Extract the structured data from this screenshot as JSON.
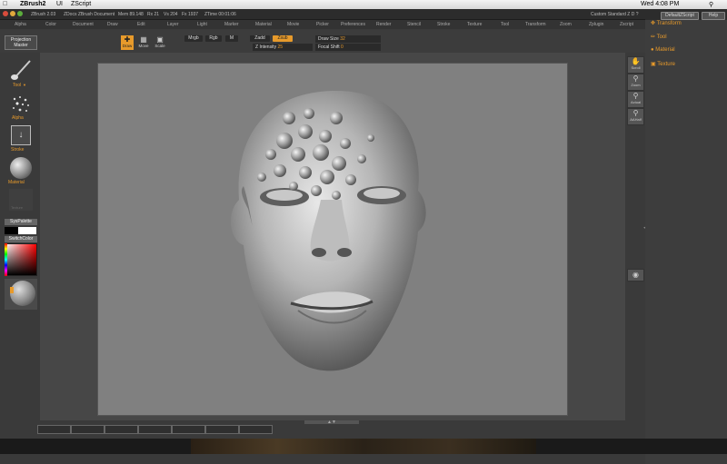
{
  "mac": {
    "app": "ZBrush2",
    "menus": [
      "UI",
      "ZScript"
    ],
    "clock": "Wed 4:08 PM"
  },
  "titlebar": {
    "version": "ZBrush 2.03",
    "doc": "ZDocs ZBrush Document",
    "mem": "Mem 89.148",
    "rx": "Rx 21",
    "vs": "Vs 204",
    "fx": "Fx 1937",
    "ztime": "ZTime 00:01:06",
    "right": "Custom Standard Z D ?",
    "default_script": "DefaultZScript",
    "help": "Help"
  },
  "menus": [
    "Alpha",
    "Color",
    "Document",
    "Draw",
    "Edit",
    "Layer",
    "Light",
    "Marker",
    "Material",
    "Movie",
    "Picker",
    "Preferences",
    "Render",
    "Stencil",
    "Stroke",
    "Texture",
    "Tool",
    "Transform",
    "Zoom",
    "Zplugin",
    "Zscript"
  ],
  "shelf": {
    "projection_master": "Projection Master",
    "draw": "Draw",
    "move": "Move",
    "scale": "Scale",
    "mrgb": "Mrgb",
    "rgb": "Rgb",
    "m": "M",
    "zadd": "Zadd",
    "zsub": "Zsub",
    "draw_size_label": "Draw Size",
    "draw_size": "32",
    "z_intensity_label": "Z Intensity",
    "z_intensity": "25",
    "focal_shift_label": "Focal Shift",
    "focal_shift": "0"
  },
  "left": {
    "tool": "Tool",
    "alpha": "Alpha",
    "stroke": "Stroke",
    "material": "Material",
    "texture": "Texture",
    "sys_palette": "SysPalette",
    "switch_color": "SwitchColor"
  },
  "right_tools": [
    "Scroll",
    "Zoom",
    "Actual",
    "AAHalf"
  ],
  "tray": {
    "transform": "Transform",
    "tool": "Tool",
    "material": "Material",
    "texture": "Texture"
  },
  "colors": {
    "accent": "#e79a2b",
    "canvas": "#808080",
    "ui_bg": "#3a3a3a"
  }
}
